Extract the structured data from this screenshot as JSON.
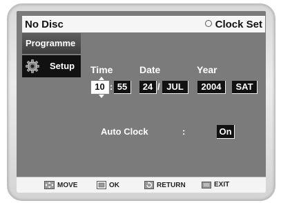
{
  "header": {
    "status": "No Disc",
    "page_title": "Clock Set"
  },
  "menu": {
    "items": [
      {
        "label": "Programme",
        "selected": false
      },
      {
        "label": "Setup",
        "selected": true,
        "icon": "gear-icon"
      }
    ]
  },
  "clock": {
    "time_label": "Time",
    "date_label": "Date",
    "year_label": "Year",
    "hour": "10",
    "minute": "55",
    "day": "24",
    "month": "JUL",
    "year": "2004",
    "weekday": "SAT",
    "time_separator": ":",
    "date_separator": "/"
  },
  "auto_clock": {
    "label": "Auto Clock",
    "separator": ":",
    "value": "On"
  },
  "footer": {
    "items": [
      {
        "label": "MOVE",
        "icon": "move-icon"
      },
      {
        "label": "OK",
        "icon": "ok-icon"
      },
      {
        "label": "RETURN",
        "icon": "return-icon"
      },
      {
        "label": "EXIT",
        "icon": "exit-icon"
      }
    ]
  },
  "colors": {
    "screen_bg": "#7b7b7b",
    "highlight": "#ffffff",
    "field_bg": "#111111"
  }
}
